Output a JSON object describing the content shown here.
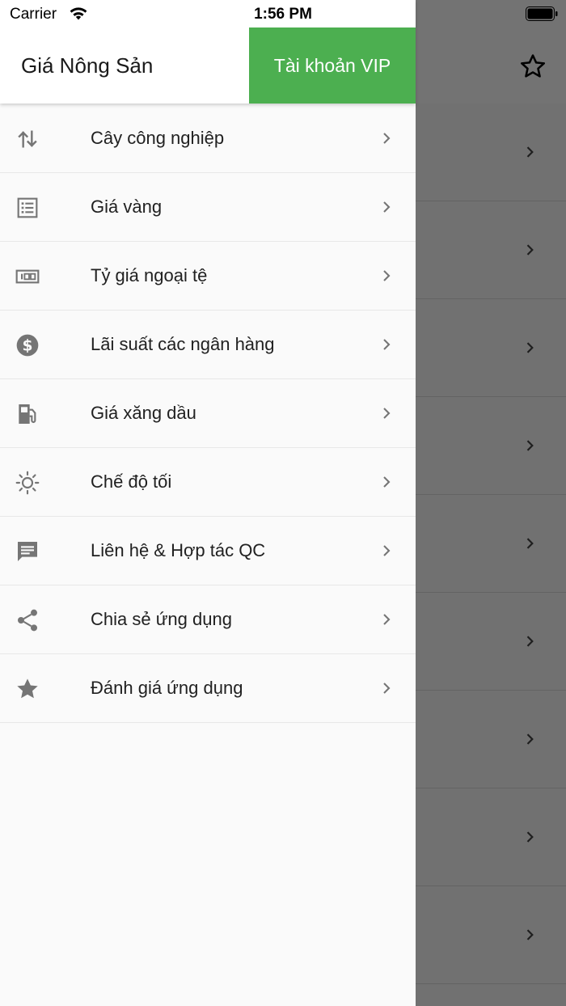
{
  "status_bar": {
    "carrier": "Carrier",
    "time": "1:56 PM"
  },
  "drawer": {
    "title": "Giá Nông Sản",
    "vip_label": "Tài khoản VIP",
    "accent_color": "#4caf50",
    "items": [
      {
        "label": "Cây công nghiệp",
        "icon": "swap-vertical-icon"
      },
      {
        "label": "Giá vàng",
        "icon": "list-icon"
      },
      {
        "label": "Tỷ giá ngoại tệ",
        "icon": "money-icon"
      },
      {
        "label": "Lãi suất các ngân hàng",
        "icon": "dollar-circle-icon"
      },
      {
        "label": "Giá xăng dầu",
        "icon": "gas-station-icon"
      },
      {
        "label": "Chế độ tối",
        "icon": "brightness-icon"
      },
      {
        "label": "Liên hệ & Hợp tác QC",
        "icon": "message-icon"
      },
      {
        "label": "Chia sẻ ứng dụng",
        "icon": "share-icon"
      },
      {
        "label": "Đánh giá ứng dụng",
        "icon": "star-icon"
      }
    ]
  }
}
